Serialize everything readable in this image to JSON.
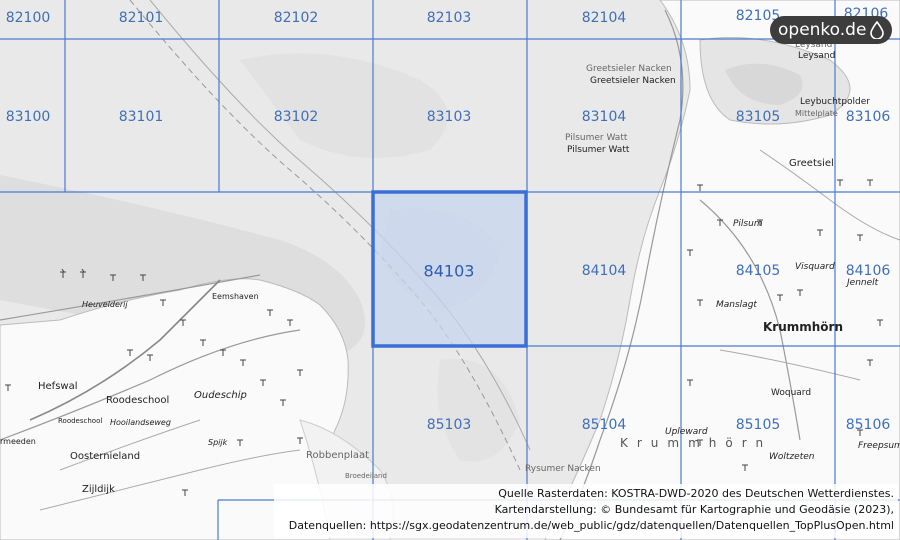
{
  "logo": {
    "text": "openko.de"
  },
  "grid": {
    "selected_cell": "84103",
    "cells": [
      {
        "id": "82100"
      },
      {
        "id": "82101"
      },
      {
        "id": "82102"
      },
      {
        "id": "82103"
      },
      {
        "id": "82104"
      },
      {
        "id": "82105"
      },
      {
        "id": "82106"
      },
      {
        "id": "83100"
      },
      {
        "id": "83101"
      },
      {
        "id": "83102"
      },
      {
        "id": "83103"
      },
      {
        "id": "83104"
      },
      {
        "id": "83105"
      },
      {
        "id": "83106"
      },
      {
        "id": "84103"
      },
      {
        "id": "84104"
      },
      {
        "id": "84105"
      },
      {
        "id": "84106"
      },
      {
        "id": "85103"
      },
      {
        "id": "85104"
      },
      {
        "id": "85105"
      },
      {
        "id": "85106"
      }
    ]
  },
  "places": {
    "greetsieler_nacken_1": "Greetsieler Nacken",
    "greetsieler_nacken_2": "Greetsieler Nacken",
    "pilsumer_watt_1": "Pilsumer Watt",
    "pilsumer_watt_2": "Pilsumer Watt",
    "leysand_1": "Leysand",
    "leysand_2": "Leysand",
    "leybuchtpolder": "Leybuchtpolder",
    "mittelplate": "Mittelplate",
    "greetsiel": "Greetsiel",
    "pilsum": "Pilsum",
    "visquard": "Visquard",
    "jennelt": "Jennelt",
    "manslagt": "Manslagt",
    "krummhoern": "Krummhörn",
    "woquard": "Woquard",
    "upleward": "Upleward",
    "krummhoern_region": "Krummhörn",
    "woltzeten": "Woltzeten",
    "freepsum": "Freepsum",
    "rysumer_nacken": "Rysumer Nacken",
    "heuvelderij": "Heuvelderij",
    "eemshaven": "Eemshaven",
    "hefswal": "Hefswal",
    "roodeschool": "Roodeschool",
    "roodeschool_small": "Roodeschool",
    "oudeschip": "Oudeschip",
    "hooilandseweg": "Hooilandseweg",
    "spijk": "Spijk",
    "oosternieland": "Oosternieland",
    "robbenplaat": "Robbenplaat",
    "zijldijk": "Zijldijk",
    "broedeiland": "Broedeiland",
    "uithuizermeeden": "rmeeden"
  },
  "credits": {
    "line1": "Quelle Rasterdaten: KOSTRA-DWD-2020 des Deutschen Wetterdienstes.",
    "line2": "Kartendarstellung: © Bundesamt für Kartographie und Geodäsie (2023),",
    "line3": "Datenquellen: https://sgx.geodatenzentrum.de/web_public/gdz/datenquellen/Datenquellen_TopPlusOpen.html"
  },
  "colors": {
    "sea": "#e9e9e9",
    "land": "#fafafa",
    "grid_line": "#4a7bd0",
    "selected_fill": "#c7d4ee",
    "selected_stroke": "#3a6fd8",
    "logo_bg": "#3d3d3d"
  }
}
